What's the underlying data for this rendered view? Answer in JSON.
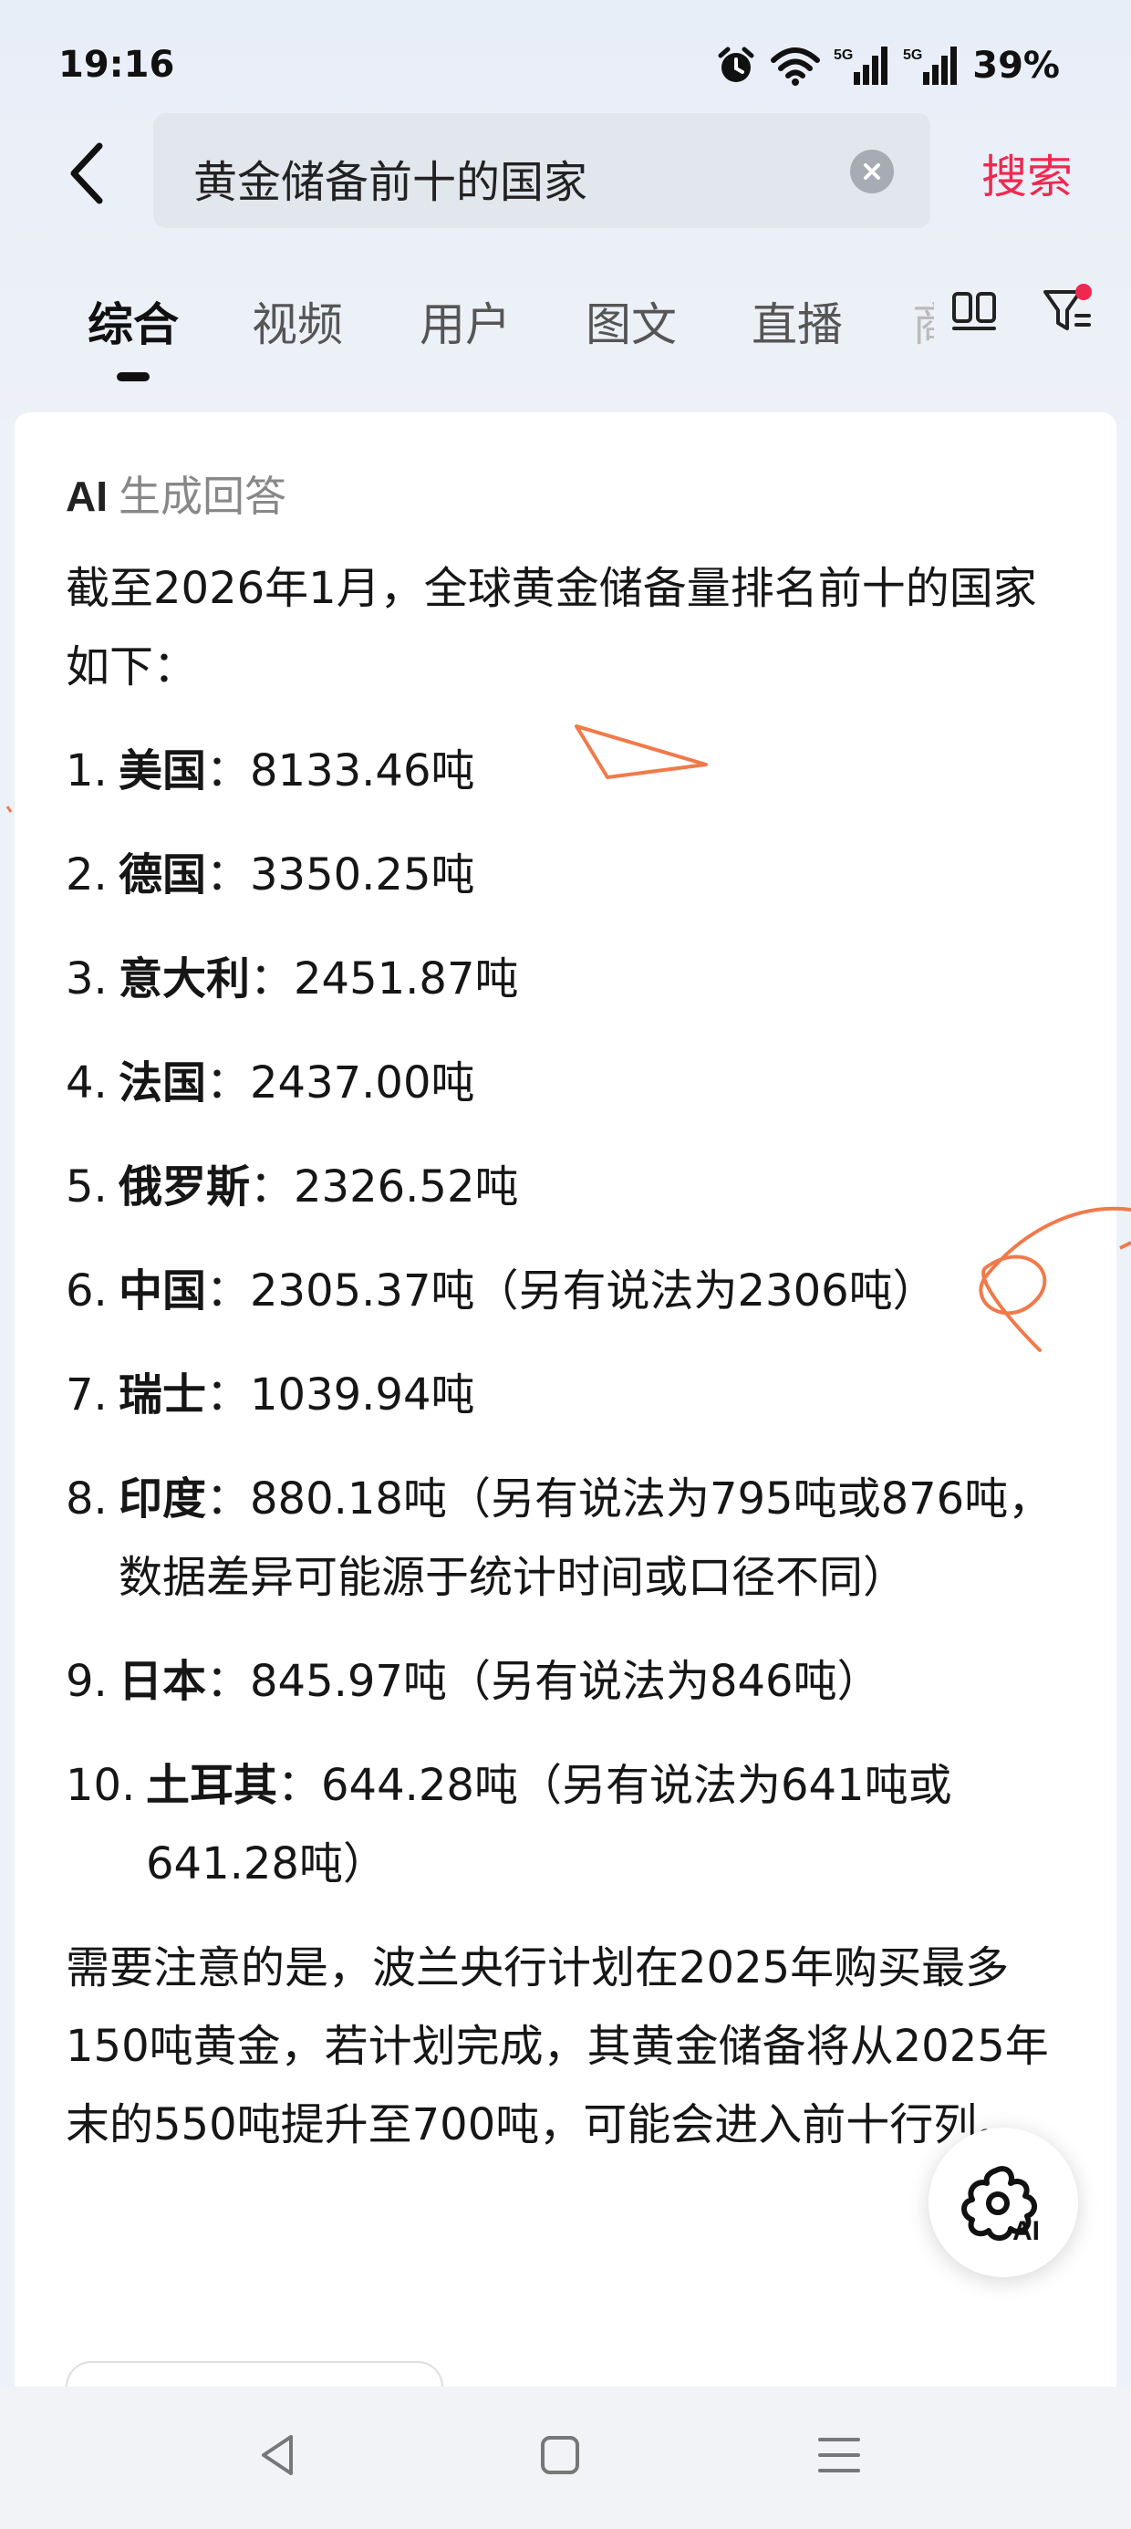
{
  "status": {
    "time": "19:16",
    "network_label": "5G",
    "battery": "39%"
  },
  "search": {
    "query": "黄金储备前十的国家",
    "button_label": "搜索"
  },
  "tabs": {
    "items": [
      {
        "label": "综合",
        "active": true
      },
      {
        "label": "视频",
        "active": false
      },
      {
        "label": "用户",
        "active": false
      },
      {
        "label": "图文",
        "active": false
      },
      {
        "label": "直播",
        "active": false
      }
    ],
    "partial_next": "商"
  },
  "ai_answer": {
    "badge": "AI",
    "label": "生成回答",
    "intro": "截至2026年1月，全球黄金储备量排名前十的国家如下：",
    "ranking": [
      {
        "num": "1.",
        "country": "美国",
        "detail": "：8133.46吨"
      },
      {
        "num": "2.",
        "country": "德国",
        "detail": "：3350.25吨"
      },
      {
        "num": "3.",
        "country": "意大利",
        "detail": "：2451.87吨"
      },
      {
        "num": "4.",
        "country": "法国",
        "detail": "：2437.00吨"
      },
      {
        "num": "5.",
        "country": "俄罗斯",
        "detail": "：2326.52吨"
      },
      {
        "num": "6.",
        "country": "中国",
        "detail": "：2305.37吨（另有说法为2306吨）"
      },
      {
        "num": "7.",
        "country": "瑞士",
        "detail": "：1039.94吨"
      },
      {
        "num": "8.",
        "country": "印度",
        "detail": "：880.18吨（另有说法为795吨或876吨，数据差异可能源于统计时间或口径不同）"
      },
      {
        "num": "9.",
        "country": "日本",
        "detail": "：845.97吨（另有说法为846吨）"
      },
      {
        "num": "10.",
        "country": "土耳其",
        "detail": "：644.28吨（另有说法为641吨或641.28吨）"
      }
    ],
    "note": "需要注意的是，波兰央行计划在2025年购买最多150吨黄金，若计划完成，其黄金储备将从2025年末的550吨提升至700吨，可能会进入前十行列。"
  },
  "fab": {
    "label": "AI"
  },
  "colors": {
    "accent": "#f0284f",
    "annotation": "#f07a4a",
    "background": "#edf1f8"
  },
  "icons": [
    "alarm-icon",
    "wifi-icon",
    "signal-icon",
    "back-arrow-icon",
    "clear-icon",
    "layout-icon",
    "filter-icon",
    "ai-assistant-icon",
    "nav-back-icon",
    "nav-home-icon",
    "nav-menu-icon"
  ]
}
